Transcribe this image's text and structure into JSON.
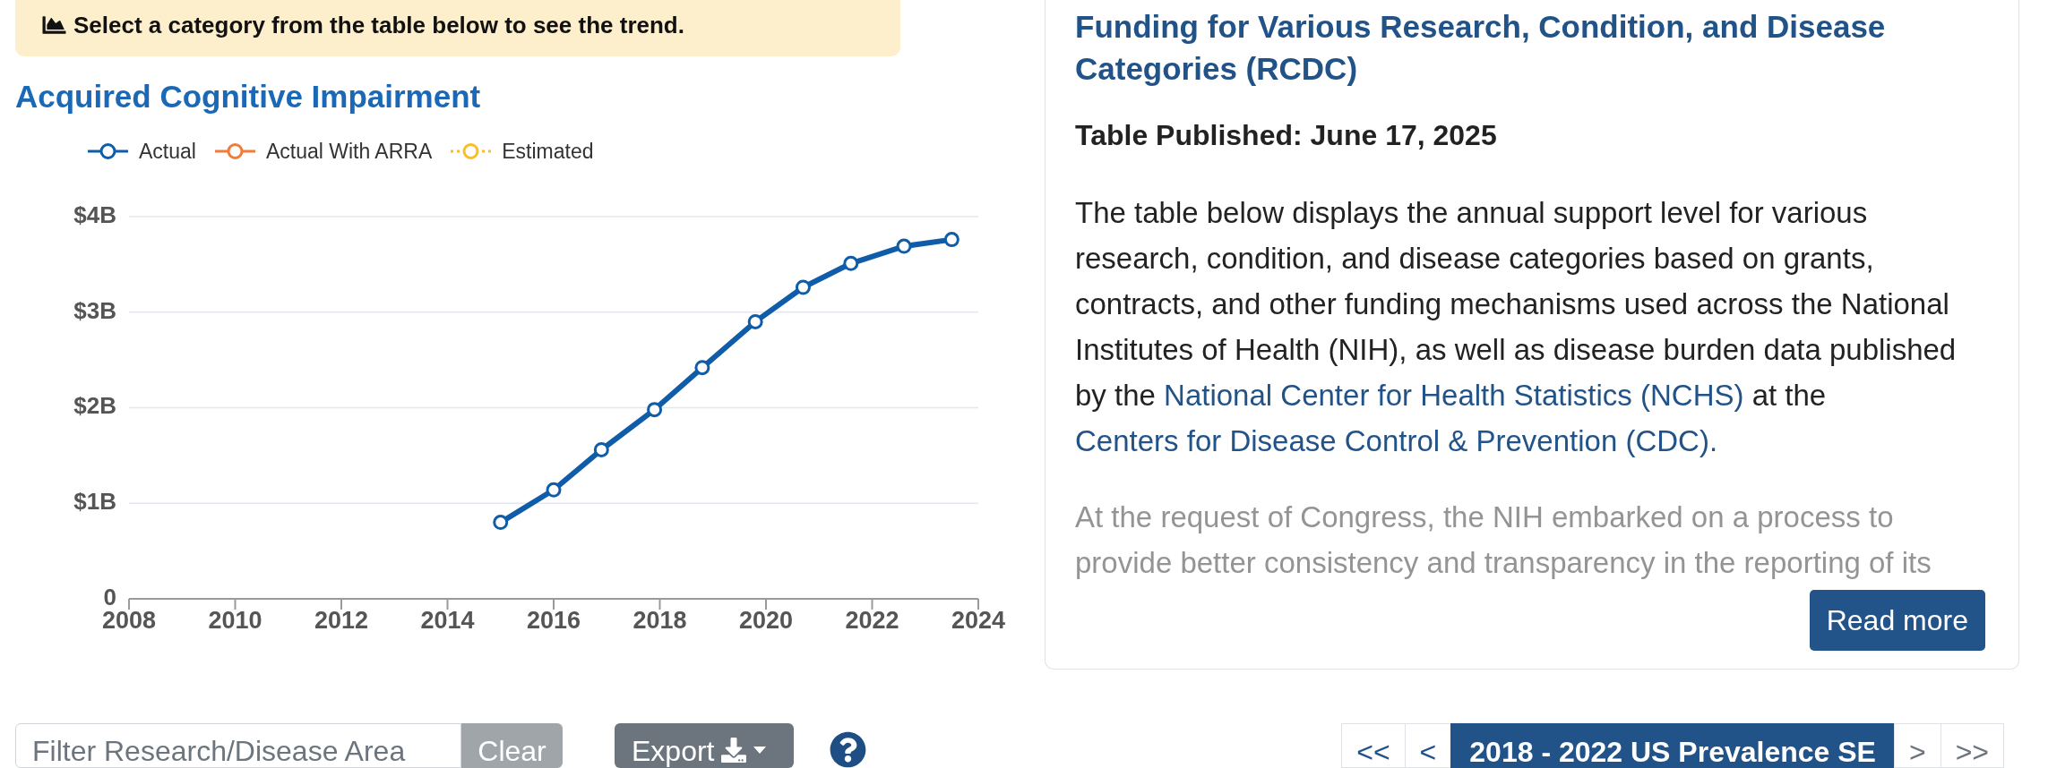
{
  "banner": {
    "text": "Select a category from the table below to see the trend."
  },
  "chart_title": "Acquired Cognitive Impairment",
  "legend": [
    {
      "kind": "solid"
    },
    {
      "kind": "solid"
    },
    {
      "kind": "dotted"
    }
  ],
  "chart_data": {
    "type": "line",
    "grid": true,
    "x": [
      2015.0,
      2016.0,
      2016.9,
      2017.9,
      2018.8,
      2019.8,
      2020.7,
      2021.6,
      2022.6,
      2023.5
    ],
    "series": [
      {
        "name": "Actual",
        "color": "#0f5ca8",
        "marker": "circle",
        "values": [
          0.8,
          1.14,
          1.56,
          1.98,
          2.42,
          2.9,
          3.26,
          3.51,
          3.69,
          3.76
        ]
      },
      {
        "name": "Actual With ARRA",
        "color": "#ee7d3b",
        "marker": "circle",
        "values": [
          null,
          null,
          null,
          null,
          null,
          null,
          null,
          null,
          null,
          null
        ]
      },
      {
        "name": "Estimated",
        "color": "#fbbd23",
        "marker": "circle",
        "values": [
          null,
          null,
          null,
          null,
          null,
          null,
          null,
          null,
          null,
          null
        ]
      }
    ],
    "xlim": [
      2008,
      2024
    ],
    "ylim": [
      0,
      4
    ],
    "xticks": [
      2008,
      2010,
      2012,
      2014,
      2016,
      2018,
      2020,
      2022,
      2024
    ],
    "yticks": [
      {
        "value": 0,
        "label": "0"
      },
      {
        "value": 1,
        "label": "$1B"
      },
      {
        "value": 2,
        "label": "$2B"
      },
      {
        "value": 3,
        "label": "$3B"
      },
      {
        "value": 4,
        "label": "$4B"
      }
    ]
  },
  "info_card": {
    "title": "Funding for Various Research, Condition, and Disease Categories (RCDC)",
    "published": "Table Published: June 17, 2025",
    "intro": [
      {
        "kind": "text",
        "text": "The table below displays the annual support level for various research, condition, and disease categories based on grants, contracts, and other funding mechanisms used across the National Institutes of Health (NIH), as well as disease burden data published by the "
      },
      {
        "kind": "link",
        "text": "National Center for Health Statistics (NCHS)"
      },
      {
        "kind": "text",
        "text": " at the "
      },
      {
        "kind": "link",
        "text": "Centers for Disease Control & Prevention (CDC)."
      }
    ],
    "more_text": "At the request of Congress, the NIH embarked on a process to provide better consistency and transparency in the reporting of its",
    "read_more": "Read more"
  },
  "filter": {
    "placeholder": "Filter Research/Disease Area",
    "clear": "Clear"
  },
  "export": {
    "label": "Export"
  },
  "pagination": [
    {
      "label": "<<",
      "selected": false,
      "disabled": false
    },
    {
      "label": "<",
      "selected": false,
      "disabled": false
    },
    {
      "label": "2018 - 2022 US Prevalence SE",
      "selected": true,
      "disabled": false
    },
    {
      "label": ">",
      "selected": false,
      "disabled": true
    },
    {
      "label": ">>",
      "selected": false,
      "disabled": true
    }
  ]
}
